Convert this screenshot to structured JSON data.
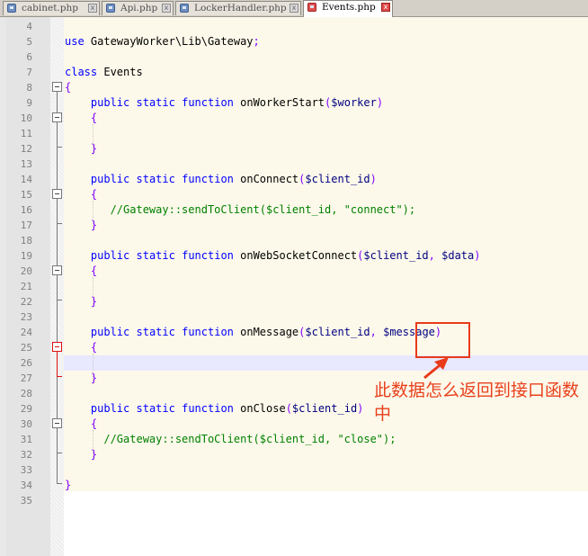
{
  "tabs": [
    {
      "label": "cabinet.php",
      "active": false
    },
    {
      "label": "Api.php",
      "active": false
    },
    {
      "label": "LockerHandler.php",
      "active": false
    },
    {
      "label": "Events.php",
      "active": true
    }
  ],
  "editor": {
    "current_line": 26,
    "lines": [
      {
        "num": "4",
        "text": ""
      },
      {
        "num": "5",
        "text": "use GatewayWorker\\Lib\\Gateway;"
      },
      {
        "num": "6",
        "text": ""
      },
      {
        "num": "7",
        "text": "class Events"
      },
      {
        "num": "8",
        "text": "{"
      },
      {
        "num": "9",
        "text": "    public static function onWorkerStart($worker)"
      },
      {
        "num": "10",
        "text": "    {"
      },
      {
        "num": "11",
        "text": ""
      },
      {
        "num": "12",
        "text": "    }"
      },
      {
        "num": "13",
        "text": ""
      },
      {
        "num": "14",
        "text": "    public static function onConnect($client_id)"
      },
      {
        "num": "15",
        "text": "    {"
      },
      {
        "num": "16",
        "text": "       //Gateway::sendToClient($client_id, \"connect\");"
      },
      {
        "num": "17",
        "text": "    }"
      },
      {
        "num": "18",
        "text": ""
      },
      {
        "num": "19",
        "text": "    public static function onWebSocketConnect($client_id, $data)"
      },
      {
        "num": "20",
        "text": "    {"
      },
      {
        "num": "21",
        "text": ""
      },
      {
        "num": "22",
        "text": "    }"
      },
      {
        "num": "23",
        "text": ""
      },
      {
        "num": "24",
        "text": "    public static function onMessage($client_id, $message)"
      },
      {
        "num": "25",
        "text": "    {"
      },
      {
        "num": "26",
        "text": ""
      },
      {
        "num": "27",
        "text": "    }"
      },
      {
        "num": "28",
        "text": ""
      },
      {
        "num": "29",
        "text": "    public static function onClose($client_id)"
      },
      {
        "num": "30",
        "text": "    {"
      },
      {
        "num": "31",
        "text": "      //Gateway::sendToClient($client_id, \"close\");"
      },
      {
        "num": "32",
        "text": "    }"
      },
      {
        "num": "33",
        "text": ""
      },
      {
        "num": "34",
        "text": "}"
      },
      {
        "num": "35",
        "text": ""
      }
    ]
  },
  "annotation": {
    "text": "此数据怎么返回到接口函数中",
    "color": "#e8401c"
  }
}
